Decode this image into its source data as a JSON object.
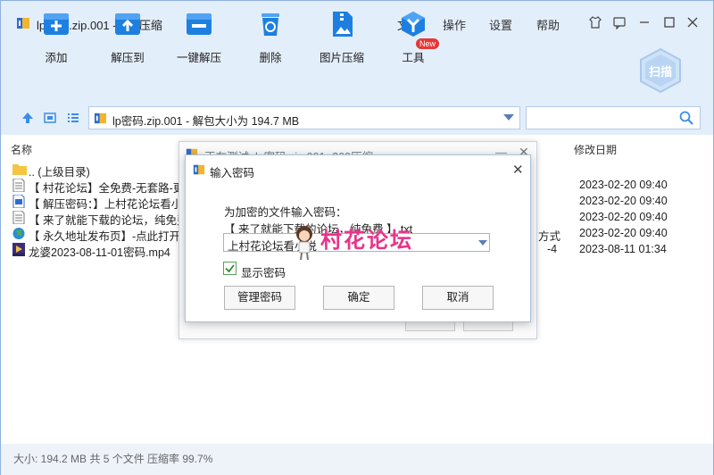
{
  "window": {
    "title": "lp密码.zip.001 - 360压缩",
    "menus": [
      "文件",
      "操作",
      "设置",
      "帮助"
    ]
  },
  "toolbar": {
    "items": [
      {
        "label": "添加",
        "icon": "add-icon"
      },
      {
        "label": "解压到",
        "icon": "extract-icon"
      },
      {
        "label": "一键解压",
        "icon": "one-click-extract-icon"
      },
      {
        "label": "删除",
        "icon": "delete-icon"
      },
      {
        "label": "图片压缩",
        "icon": "image-compress-icon"
      },
      {
        "label": "工具",
        "icon": "tools-icon"
      }
    ],
    "new_badge": "New",
    "scan_label": "扫描"
  },
  "address": {
    "path": "lp密码.zip.001 - 解包大小为 194.7 MB"
  },
  "list": {
    "col_name": "名称",
    "col_date": "修改日期",
    "rows": [
      {
        "name": ".. (上级目录)",
        "date": "",
        "mid": "",
        "icon": "folder-icon"
      },
      {
        "name": "【 村花论坛】全免费-无套路-更",
        "date": "2023-02-20 09:40",
        "mid": "",
        "icon": "text-file-icon"
      },
      {
        "name": "【 解压密码：】上村花论坛看小",
        "date": "2023-02-20 09:40",
        "mid": "",
        "icon": "doc-file-icon"
      },
      {
        "name": "【 来了就能下载的论坛，纯免费",
        "date": "2023-02-20 09:40",
        "mid": "",
        "icon": "text-file-icon"
      },
      {
        "name": "【 永久地址发布页】-点此打开.",
        "date": "2023-02-20 09:40",
        "mid": "方式",
        "icon": "globe-icon"
      },
      {
        "name": "龙婆2023-08-11-01密码.mp4",
        "date": "2023-08-11 01:34",
        "mid": "-4",
        "icon": "video-file-icon"
      }
    ]
  },
  "status": {
    "text": "大小: 194.2 MB 共 5 个文件 压缩率 99.7%"
  },
  "bg_dialog": {
    "title": "正在测试: lp密码.zip.001 -360压缩"
  },
  "dialog": {
    "title": "输入密码",
    "prompt": "为加密的文件输入密码：",
    "filename": "【 来了就能下载的论坛，纯免费 】.txt",
    "password_value": "上村花论坛看小说",
    "show_password_label": "显示密码",
    "show_password_checked": true,
    "manage_button": "管理密码",
    "ok_button": "确定",
    "cancel_button": "取消"
  },
  "watermark": {
    "text": "村花论坛"
  }
}
